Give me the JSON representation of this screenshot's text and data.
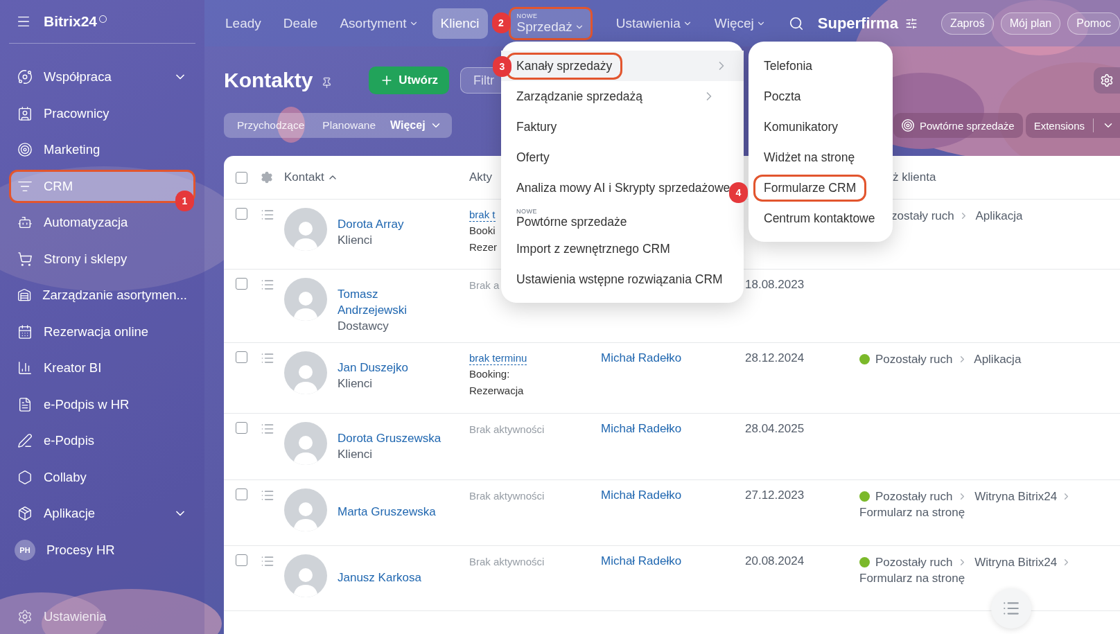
{
  "sidebar": {
    "logo": "Bitrix24",
    "items": [
      {
        "kind": "icon",
        "label": "Współpraca",
        "expandable": true,
        "selected": false
      },
      {
        "kind": "icon",
        "label": "Pracownicy",
        "expandable": false,
        "selected": false
      },
      {
        "kind": "icon",
        "label": "Marketing",
        "expandable": false,
        "selected": false
      },
      {
        "kind": "icon",
        "label": "CRM",
        "expandable": false,
        "selected": true,
        "step": "1"
      },
      {
        "kind": "icon",
        "label": "Automatyzacja",
        "expandable": false,
        "selected": false
      },
      {
        "kind": "icon",
        "label": "Strony i sklepy",
        "expandable": false,
        "selected": false
      },
      {
        "kind": "icon",
        "label": "Zarządzanie asortymen...",
        "expandable": false,
        "selected": false
      },
      {
        "kind": "icon",
        "label": "Rezerwacja online",
        "expandable": false,
        "selected": false
      },
      {
        "kind": "icon",
        "label": "Kreator BI",
        "expandable": false,
        "selected": false
      },
      {
        "kind": "icon",
        "label": "e-Podpis w HR",
        "expandable": false,
        "selected": false
      },
      {
        "kind": "icon",
        "label": "e-Podpis",
        "expandable": false,
        "selected": false
      },
      {
        "kind": "icon",
        "label": "Collaby",
        "expandable": false,
        "selected": false
      },
      {
        "kind": "icon",
        "label": "Aplikacje",
        "expandable": true,
        "selected": false
      },
      {
        "kind": "avatar",
        "initials": "PH",
        "label": "Procesy HR",
        "expandable": false,
        "selected": false
      }
    ],
    "footer": "Ustawienia"
  },
  "topbar": {
    "nav": [
      {
        "label": "Leady",
        "dropdown": false,
        "selected": false
      },
      {
        "label": "Deale",
        "dropdown": false,
        "selected": false
      },
      {
        "label": "Asortyment",
        "dropdown": true,
        "selected": false
      },
      {
        "label": "Klienci",
        "dropdown": false,
        "selected": true
      },
      {
        "label": "Sprzedaż",
        "tag": "NOWE",
        "dropdown": true,
        "selected": false,
        "step": "2"
      },
      {
        "label": "Ustawienia",
        "dropdown": true,
        "selected": false
      },
      {
        "label": "Więcej",
        "dropdown": true,
        "selected": false
      }
    ],
    "company": "Superfirma",
    "buttons": [
      "Zaproś",
      "Mój plan",
      "Pomoc"
    ]
  },
  "toolbar": {
    "title": "Kontakty",
    "create": "Utwórz",
    "filter_placeholder": "Filtr",
    "counters": [
      "Przychodzące",
      "Planowane"
    ],
    "more": "Więcej",
    "repeat_sales": "Powtórne sprzedaże",
    "extensions": "Extensions"
  },
  "table": {
    "header": {
      "select_all_checked": false,
      "contact": "Kontakt",
      "activity": "Akty",
      "source": "ż klienta"
    },
    "rows": [
      {
        "checked": false,
        "name": "Dorota Array",
        "group": "Klienci",
        "activity": [
          {
            "kind": "link",
            "text": "brak t"
          },
          {
            "kind": "text",
            "text": "Booki"
          },
          {
            "kind": "text",
            "text": "Rezer"
          }
        ],
        "source_icon": false,
        "source": [
          "zostały ruch",
          "Aplikacja"
        ]
      },
      {
        "checked": false,
        "name": "Tomasz Andrzejewski",
        "group": "Dostawcy",
        "activity": [
          {
            "kind": "muted",
            "text": "Brak a"
          }
        ],
        "date": "18.08.2023",
        "source_icon": false
      },
      {
        "checked": false,
        "name": "Jan Duszejko",
        "group": "Klienci",
        "activity": [
          {
            "kind": "link",
            "text": "brak terminu"
          },
          {
            "kind": "text",
            "text": "Booking:"
          },
          {
            "kind": "text",
            "text": "Rezerwacja"
          }
        ],
        "responsible": "Michał Radełko",
        "date": "28.12.2024",
        "source_icon": true,
        "source": [
          "Pozostały ruch",
          "Aplikacja"
        ]
      },
      {
        "checked": false,
        "name": "Dorota Gruszewska",
        "group": "Klienci",
        "activity": [
          {
            "kind": "muted",
            "text": "Brak aktywności"
          }
        ],
        "responsible": "Michał Radełko",
        "date": "28.04.2025",
        "source_icon": false
      },
      {
        "checked": false,
        "name": "Marta Gruszewska",
        "activity": [
          {
            "kind": "muted",
            "text": "Brak aktywności"
          }
        ],
        "responsible": "Michał Radełko",
        "date": "27.12.2023",
        "source_icon": true,
        "source": [
          "Pozostały ruch",
          "Witryna Bitrix24",
          "Formularz na stronę"
        ]
      },
      {
        "checked": false,
        "name": "Janusz Karkosa",
        "activity": [
          {
            "kind": "muted",
            "text": "Brak aktywności"
          }
        ],
        "responsible": "Michał Radełko",
        "date": "20.08.2024",
        "source_icon": true,
        "source": [
          "Pozostały ruch",
          "Witryna Bitrix24",
          "Formularz na stronę"
        ]
      }
    ]
  },
  "sales_menu": {
    "items": [
      {
        "label": "Kanały sprzedaży",
        "submenu": true,
        "highlighted": true,
        "step": "3"
      },
      {
        "label": "Zarządzanie sprzedażą",
        "submenu": true,
        "highlighted": false
      },
      {
        "label": "Faktury",
        "submenu": false,
        "highlighted": false
      },
      {
        "label": "Oferty",
        "submenu": false,
        "highlighted": false
      },
      {
        "label": "Analiza mowy AI i Skrypty sprzedażowe",
        "submenu": false,
        "highlighted": false
      },
      {
        "label": "Powtórne sprzedaże",
        "tag": "NOWE",
        "submenu": false,
        "highlighted": false
      },
      {
        "label": "Import z zewnętrznego CRM",
        "submenu": false,
        "highlighted": false
      },
      {
        "label": "Ustawienia wstępne rozwiązania CRM",
        "submenu": false,
        "highlighted": false
      }
    ]
  },
  "channels_menu": {
    "items": [
      {
        "label": "Telefonia"
      },
      {
        "label": "Poczta"
      },
      {
        "label": "Komunikatory"
      },
      {
        "label": "Widżet na stronę"
      },
      {
        "label": "Formularze CRM",
        "step": "4"
      },
      {
        "label": "Centrum kontaktowe"
      }
    ]
  }
}
